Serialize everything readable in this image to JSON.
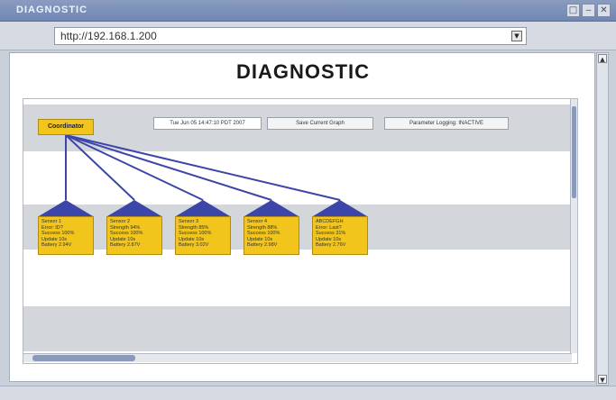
{
  "window": {
    "title": "DIAGNOSTIC",
    "controls": [
      "□",
      "‒",
      "✕"
    ]
  },
  "address": {
    "url": "http://192.168.1.200"
  },
  "page": {
    "title": "DIAGNOSTIC"
  },
  "toolbar": {
    "timestamp": "Tue Jun 05 14:47:10 PDT 2007",
    "save_label": "Save Current Graph",
    "logging_label": "Parameter Logging: INACTIVE"
  },
  "coordinator": {
    "label": "Coordinator"
  },
  "nodes": [
    {
      "lines": [
        "Sensor 1",
        "Error: ID?",
        "Success 100%",
        "Update 10s",
        "Battery 2.94V"
      ]
    },
    {
      "lines": [
        "Sensor 2",
        "Strength 94%",
        "Success 100%",
        "Update 10s",
        "Battery 2.87V"
      ]
    },
    {
      "lines": [
        "Sensor 3",
        "Strength 85%",
        "Success 100%",
        "Update 10s",
        "Battery 3.02V"
      ]
    },
    {
      "lines": [
        "Sensor 4",
        "Strength 88%",
        "Success 100%",
        "Update 10s",
        "Battery 2.98V"
      ]
    },
    {
      "lines": [
        "ABCDEFGH",
        "Error: Last?",
        "Success 31%",
        "Update 10s",
        "Battery 2.76V"
      ]
    }
  ],
  "colors": {
    "link": "#3c46a8",
    "node_fill": "#f2c51d",
    "band": "#d3d6da"
  }
}
